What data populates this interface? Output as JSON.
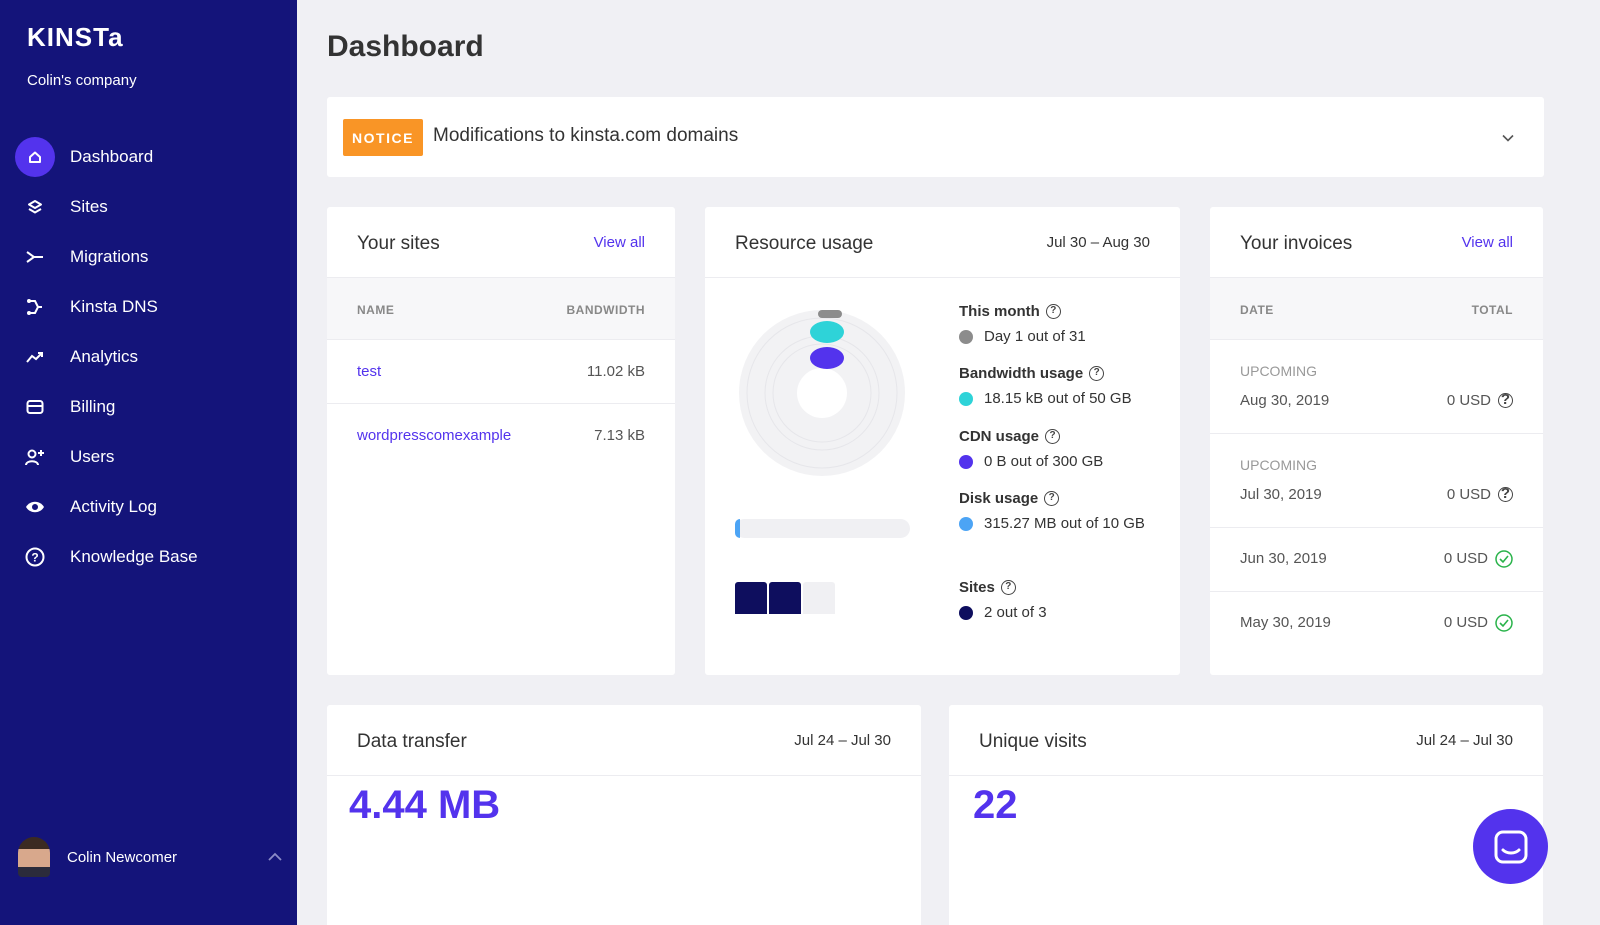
{
  "sidebar": {
    "logo": "KINSTa",
    "company": "Colin's company",
    "items": [
      {
        "label": "Dashboard",
        "icon": "home-icon",
        "active": true
      },
      {
        "label": "Sites",
        "icon": "layers-icon"
      },
      {
        "label": "Migrations",
        "icon": "migrate-icon"
      },
      {
        "label": "Kinsta DNS",
        "icon": "dns-icon"
      },
      {
        "label": "Analytics",
        "icon": "trend-icon"
      },
      {
        "label": "Billing",
        "icon": "card-icon"
      },
      {
        "label": "Users",
        "icon": "user-add-icon"
      },
      {
        "label": "Activity Log",
        "icon": "eye-icon"
      },
      {
        "label": "Knowledge Base",
        "icon": "help-icon"
      }
    ],
    "user_name": "Colin Newcomer"
  },
  "page_title": "Dashboard",
  "notice": {
    "badge": "NOTICE",
    "text": "Modifications to kinsta.com domains"
  },
  "sites_card": {
    "title": "Your sites",
    "link": "View all",
    "col_name": "NAME",
    "col_bandwidth": "BANDWIDTH",
    "rows": [
      {
        "name": "test",
        "bandwidth": "11.02 kB"
      },
      {
        "name": "wordpresscomexample",
        "bandwidth": "7.13 kB"
      }
    ]
  },
  "resource_card": {
    "title": "Resource usage",
    "date": "Jul 30 – Aug 30",
    "stats": [
      {
        "label": "This month",
        "value": "Day 1 out of 31",
        "color": "#8c8c8c"
      },
      {
        "label": "Bandwidth usage",
        "value": "18.15 kB out of 50 GB",
        "color": "#2ed3d8"
      },
      {
        "label": "CDN usage",
        "value": "0 B out of 300 GB",
        "color": "#5333ed"
      },
      {
        "label": "Disk usage",
        "value": "315.27 MB out of 10 GB",
        "color": "#4ca4f5"
      },
      {
        "label": "Sites",
        "value": "2 out of 3",
        "color": "#0e0e5e"
      }
    ],
    "sites_used": 2,
    "sites_total": 3,
    "disk_fraction": 0.03
  },
  "invoices_card": {
    "title": "Your invoices",
    "link": "View all",
    "col_date": "DATE",
    "col_total": "TOTAL",
    "rows": [
      {
        "status": "UPCOMING",
        "date": "Aug 30, 2019",
        "total": "0 USD",
        "icon": "help-icon"
      },
      {
        "status": "UPCOMING",
        "date": "Jul 30, 2019",
        "total": "0 USD",
        "icon": "help-icon"
      },
      {
        "status": "",
        "date": "Jun 30, 2019",
        "total": "0 USD",
        "icon": "check-circle-icon"
      },
      {
        "status": "",
        "date": "May 30, 2019",
        "total": "0 USD",
        "icon": "check-circle-icon"
      }
    ]
  },
  "transfer_card": {
    "title": "Data transfer",
    "date": "Jul 24 – Jul 30",
    "value": "4.44 MB"
  },
  "visits_card": {
    "title": "Unique visits",
    "date": "Jul 24 – Jul 30",
    "value": "22"
  },
  "colors": {
    "sidebar": "#14147a",
    "accent": "#5333ed",
    "notice": "#f99526",
    "success": "#29b34a"
  }
}
